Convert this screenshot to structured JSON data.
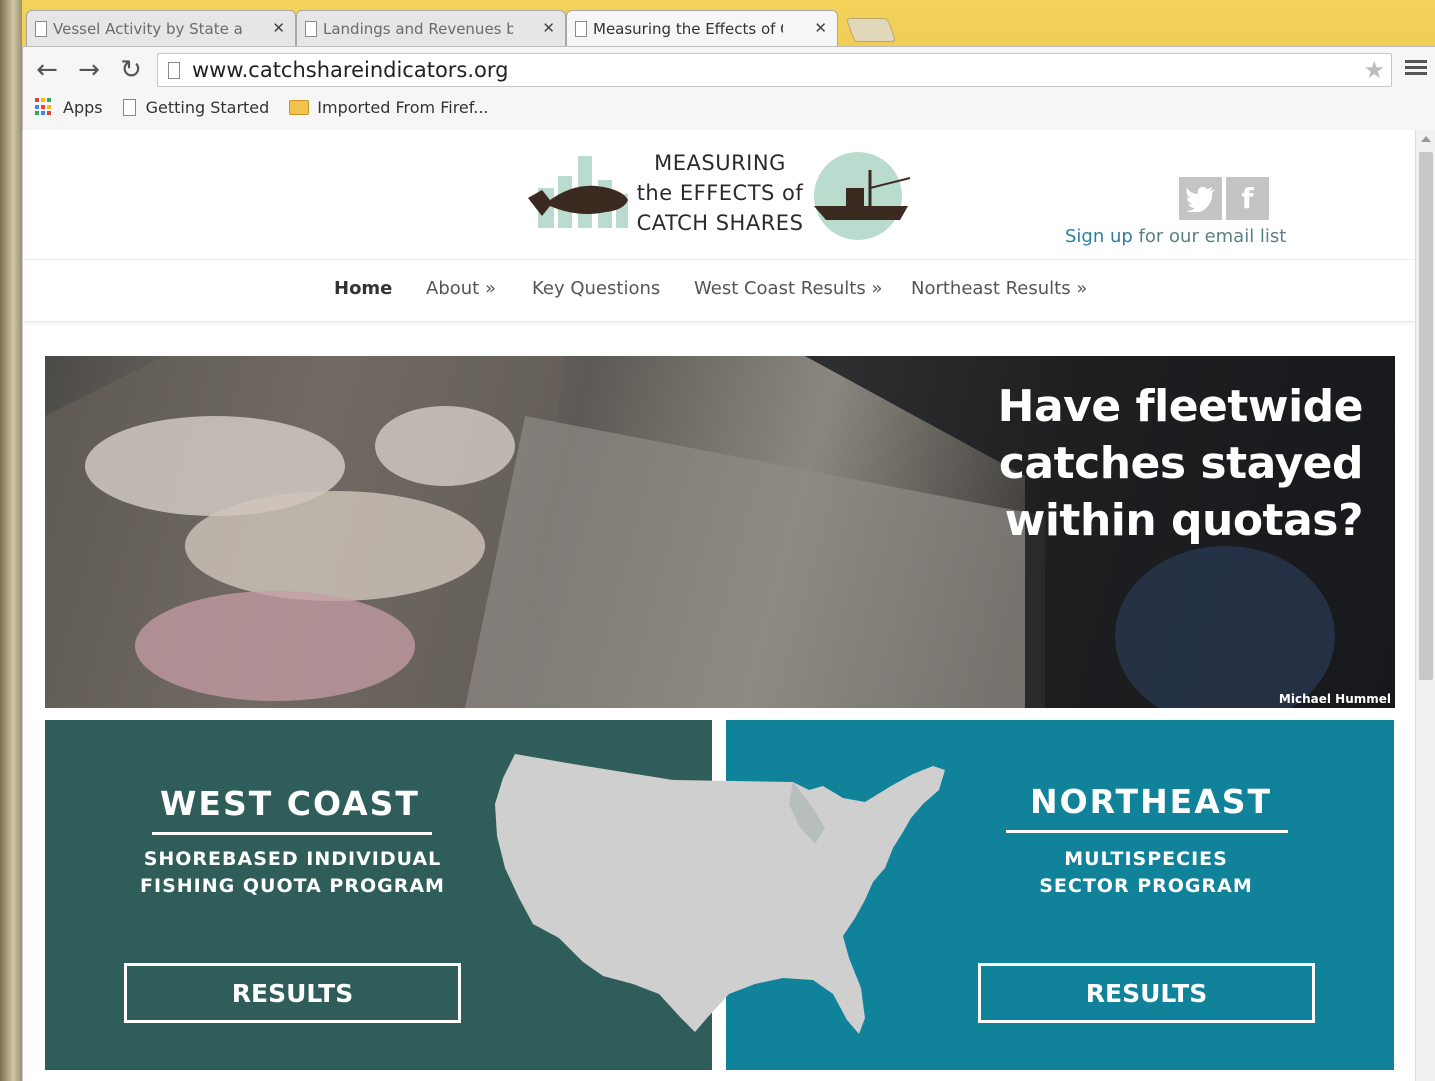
{
  "browser": {
    "tabs": [
      {
        "label": "Vessel Activity by State an",
        "active": false
      },
      {
        "label": "Landings and Revenues b",
        "active": false
      },
      {
        "label": "Measuring the Effects of C",
        "active": true
      }
    ],
    "url": "www.catchshareindicators.org",
    "bookmarks": [
      {
        "label": "Apps",
        "icon": "apps-grid-icon"
      },
      {
        "label": "Getting Started",
        "icon": "page-icon"
      },
      {
        "label": "Imported From Firef...",
        "icon": "folder-icon"
      }
    ]
  },
  "site": {
    "logo_lines": [
      "MEASURING",
      "the EFFECTS of",
      "CATCH SHARES"
    ],
    "social": {
      "twitter_icon": "twitter-icon",
      "facebook_icon": "facebook-icon"
    },
    "signup_link": "Sign up",
    "signup_rest": " for our email list",
    "nav": [
      {
        "label": "Home",
        "active": true
      },
      {
        "label": "About »",
        "active": false
      },
      {
        "label": "Key Questions",
        "active": false
      },
      {
        "label": "West Coast Results »",
        "active": false
      },
      {
        "label": "Northeast Results »",
        "active": false
      }
    ],
    "hero": {
      "headline_lines": [
        "Have fleetwide",
        "catches stayed",
        "within quotas?"
      ],
      "credit": "Michael Hummel"
    },
    "west": {
      "title": "WEST COAST",
      "sub_lines": [
        "SHOREBASED INDIVIDUAL",
        "FISHING QUOTA PROGRAM"
      ],
      "button": "RESULTS",
      "color": "#2f5e5a"
    },
    "northeast": {
      "title": "NORTHEAST",
      "sub_lines": [
        "MULTISPECIES",
        "SECTOR PROGRAM"
      ],
      "button": "RESULTS",
      "color": "#10829a"
    }
  }
}
